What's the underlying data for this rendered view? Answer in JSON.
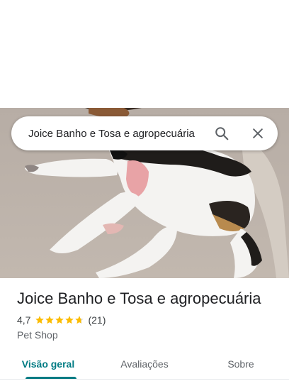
{
  "search": {
    "query": "Joice Banho e Tosa e agropecuária"
  },
  "place": {
    "name": "Joice Banho e Tosa e agropecuária",
    "rating": "4,7",
    "stars": 4.7,
    "review_count": "(21)",
    "category": "Pet Shop"
  },
  "tabs": [
    {
      "label": "Visão geral",
      "active": true
    },
    {
      "label": "Avaliações",
      "active": false
    },
    {
      "label": "Sobre",
      "active": false
    }
  ],
  "colors": {
    "accent": "#007b83",
    "star": "#fbbc04"
  },
  "icons": {
    "search": "search-icon",
    "close": "close-icon"
  }
}
